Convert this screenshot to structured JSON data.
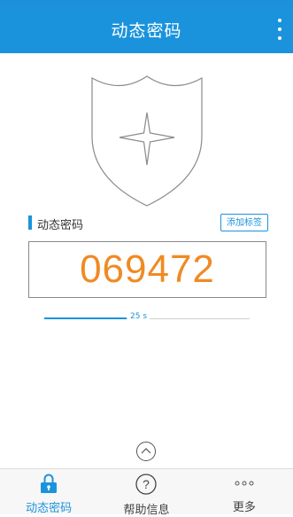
{
  "appbar": {
    "title": "动态密码",
    "menu_icon": "overflow-menu-icon"
  },
  "token": {
    "section_label": "动态密码",
    "add_tag_label": "添加标签",
    "code": "069472",
    "countdown_text": "25 s",
    "remaining_fraction": 0.4
  },
  "colors": {
    "accent": "#1b93dc",
    "code": "#f08a24"
  },
  "tabs": [
    {
      "label": "动态密码",
      "icon": "lock-icon",
      "active": true
    },
    {
      "label": "帮助信息",
      "icon": "help-icon",
      "active": false
    },
    {
      "label": "更多",
      "icon": "more-icon",
      "active": false
    }
  ]
}
